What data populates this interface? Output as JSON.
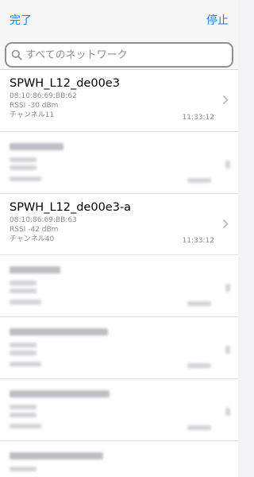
{
  "nav": {
    "done_label": "完了",
    "stop_label": "停止"
  },
  "search": {
    "placeholder": "すべてのネットワーク"
  },
  "networks": [
    {
      "ssid": "SPWH_L12_de00e3",
      "bssid": "08:10:86:69:BB:62",
      "rssi": "RSSI -30 dBm",
      "channel": "チャンネル11",
      "time": "11:33:12"
    },
    {
      "ssid": "SPWH_L12_de00e3-a",
      "bssid": "08:10:86:69:BB:63",
      "rssi": "RSSI -42 dBm",
      "channel": "チャンネル40",
      "time": "11:33:12"
    }
  ],
  "colors": {
    "accent": "#1a7df0",
    "background": "#f2f2f7",
    "secondary_text": "#8a8a8e"
  },
  "icons": {
    "search": "magnifier-icon",
    "disclosure": "chevron-right-icon"
  }
}
